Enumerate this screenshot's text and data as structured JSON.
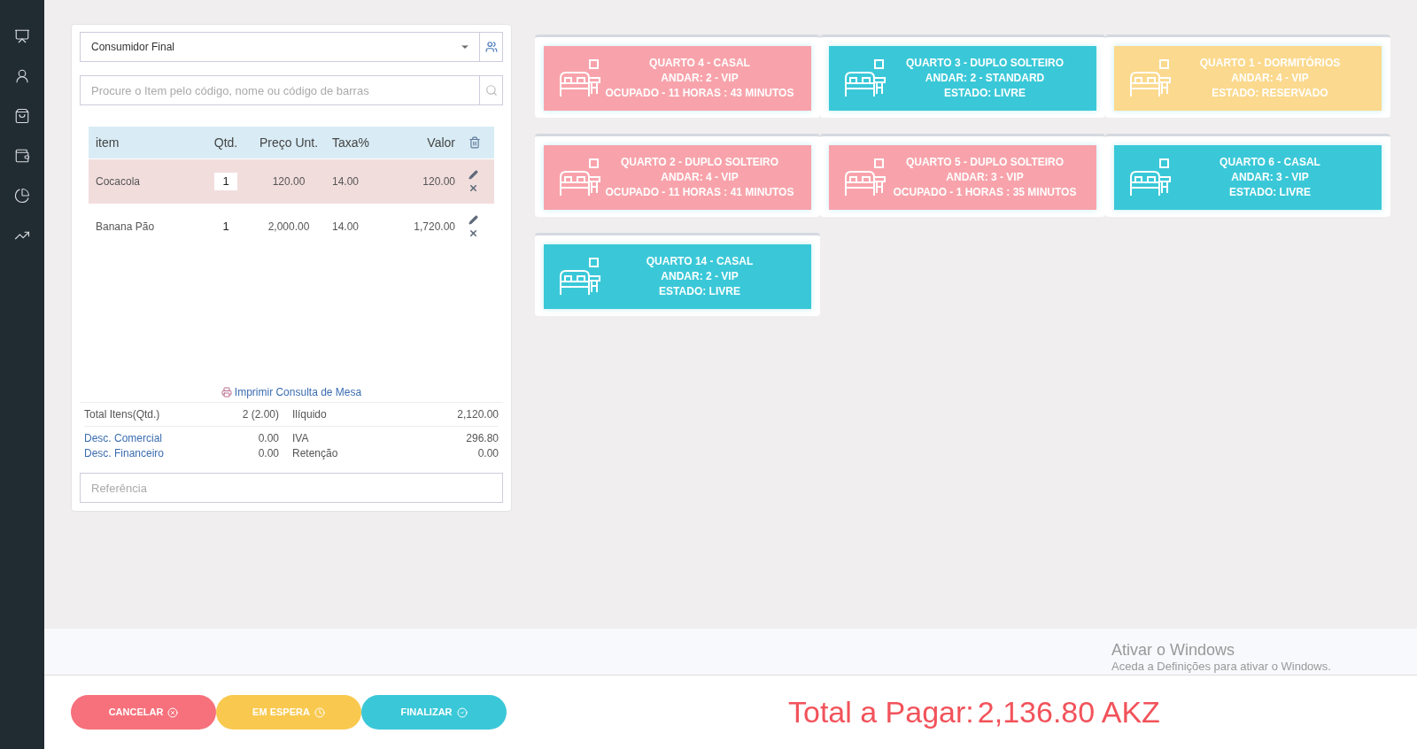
{
  "order": {
    "customer": {
      "value": "Consumidor Final"
    },
    "search": {
      "placeholder": "Procure o Item pelo código, nome ou código de barras"
    },
    "table": {
      "columns": [
        "item",
        "Qtd.",
        "Preço Unt.",
        "Taxa%",
        "Valor"
      ],
      "rows": [
        {
          "item": "Cocacola",
          "qty": "1",
          "price": "120.00",
          "tax": "14.00",
          "value": "120.00",
          "selected": true
        },
        {
          "item": "Banana Pão",
          "qty": "1",
          "price": "2,000.00",
          "tax": "14.00",
          "value": "1,720.00",
          "selected": false
        }
      ]
    },
    "print_link": "Imprimir Consulta de Mesa",
    "summary": [
      {
        "label": "Total Itens(Qtd.)",
        "value": "2 (2.00)",
        "label2": "Ilíquido",
        "value2": "2,120.00",
        "kind": "plain"
      },
      {
        "label": "Desc. Comercial",
        "value": "0.00",
        "label2": "IVA",
        "value2": "296.80",
        "kind": "link"
      },
      {
        "label": "Desc. Financeiro",
        "value": "0.00",
        "label2": "Retenção",
        "value2": "0.00",
        "kind": "link"
      }
    ],
    "reference": {
      "placeholder": "Referência"
    }
  },
  "rooms": [
    {
      "lines": [
        "QUARTO 4 - CASAL",
        "ANDAR: 2 - VIP",
        "OCUPADO - 11 HORAS : 43 MINUTOS"
      ],
      "kind": "occupied"
    },
    {
      "lines": [
        "QUARTO 3 - DUPLO SOLTEIRO",
        "ANDAR: 2 - STANDARD",
        "ESTADO: LIVRE"
      ],
      "kind": "free"
    },
    {
      "lines": [
        "QUARTO 1 - DORMITÓRIOS",
        "ANDAR: 4 - VIP",
        "ESTADO: RESERVADO"
      ],
      "kind": "reserved"
    },
    {
      "lines": [
        "QUARTO 2 - DUPLO SOLTEIRO",
        "ANDAR: 4 - VIP",
        "OCUPADO - 11 HORAS : 41 MINUTOS"
      ],
      "kind": "occupied"
    },
    {
      "lines": [
        "QUARTO 5 - DUPLO SOLTEIRO",
        "ANDAR: 3 - VIP",
        "OCUPADO - 1 HORAS : 35 MINUTOS"
      ],
      "kind": "occupied"
    },
    {
      "lines": [
        "QUARTO 6 - CASAL",
        "ANDAR: 3 - VIP",
        "ESTADO: LIVRE"
      ],
      "kind": "free"
    },
    {
      "lines": [
        "QUARTO 14 - CASAL",
        "ANDAR: 2 - VIP",
        "ESTADO: LIVRE"
      ],
      "kind": "free"
    }
  ],
  "os_notice": {
    "title": "Ativar o Windows",
    "text": "Aceda a Definições para ativar o Windows."
  },
  "actions": [
    {
      "label": "CANCELAR",
      "kind": "cancel"
    },
    {
      "label": "EM ESPERA",
      "kind": "hold"
    },
    {
      "label": "FINALIZAR",
      "kind": "finish"
    }
  ],
  "total": {
    "label": "Total a Pagar:",
    "value": "2,136.80 AKZ"
  }
}
